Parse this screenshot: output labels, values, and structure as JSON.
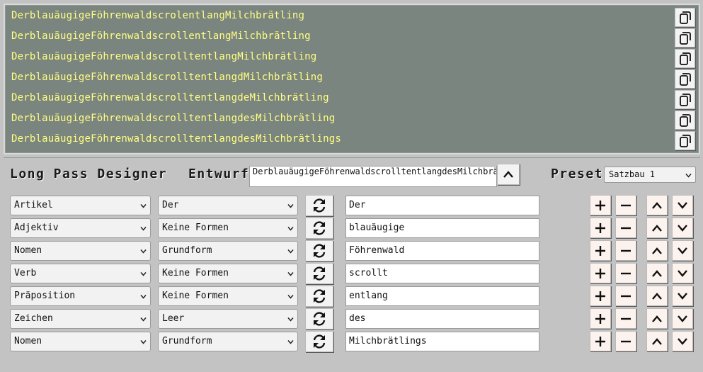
{
  "history": [
    {
      "text": "DerblauäugigeFöhrenwaldscrolentlangMilchbrätling"
    },
    {
      "text": "DerblauäugigeFöhrenwaldscrollentlangMilchbrätling"
    },
    {
      "text": "DerblauäugigeFöhrenwaldscrolltentlangMilchbrätling"
    },
    {
      "text": "DerblauäugigeFöhrenwaldscrolltentlangdMilchbrätling"
    },
    {
      "text": "DerblauäugigeFöhrenwaldscrolltentlangdeMilchbrätling"
    },
    {
      "text": "DerblauäugigeFöhrenwaldscrolltentlangdesMilchbrätling"
    },
    {
      "text": "DerblauäugigeFöhrenwaldscrolltentlangdesMilchbrätlings"
    }
  ],
  "header": {
    "title": "Long Pass Designer",
    "draft_label": "Entwurf",
    "draft_value": "DerblauäugigeFöhrenwaldscrolltentlangdesMilchbrätlings",
    "preset_label": "Preset",
    "preset_value": "Satzbau 1"
  },
  "rows": [
    {
      "category": "Artikel",
      "form": "Der",
      "word": "Der"
    },
    {
      "category": "Adjektiv",
      "form": "Keine Formen",
      "word": "blauäugige"
    },
    {
      "category": "Nomen",
      "form": "Grundform",
      "word": "Föhrenwald"
    },
    {
      "category": "Verb",
      "form": "Keine Formen",
      "word": "scrollt"
    },
    {
      "category": "Präposition",
      "form": "Keine Formen",
      "word": "entlang"
    },
    {
      "category": "Zeichen",
      "form": "Leer",
      "word": "des"
    },
    {
      "category": "Nomen",
      "form": "Grundform",
      "word": "Milchbrätlings"
    }
  ],
  "icons": {
    "copy": "copy-icon",
    "refresh": "refresh-icon",
    "plus": "plus-icon",
    "minus": "minus-icon",
    "up": "chevron-up-icon",
    "down": "chevron-down-icon"
  },
  "colors": {
    "history_bg": "#7b8580",
    "history_text": "#ffff80",
    "page_bg": "#c3c3c3",
    "icon_button_bg": "#fdf3ee"
  }
}
